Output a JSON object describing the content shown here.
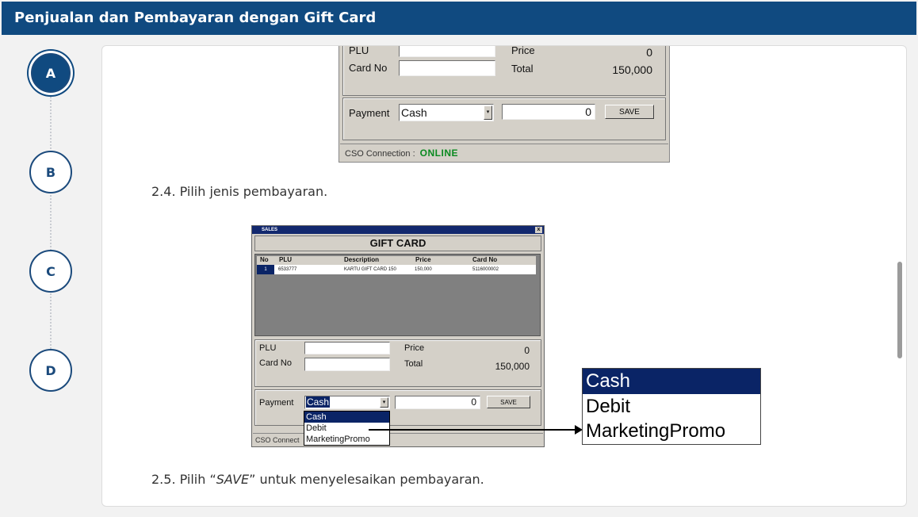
{
  "header": {
    "title": "Penjualan dan Pembayaran dengan Gift Card"
  },
  "steps": [
    {
      "label": "A",
      "active": true
    },
    {
      "label": "B",
      "active": false
    },
    {
      "label": "C",
      "active": false
    },
    {
      "label": "D",
      "active": false
    }
  ],
  "window_top": {
    "plu_label": "PLU",
    "cardno_label": "Card No",
    "price_label": "Price",
    "price_value": "0",
    "total_label": "Total",
    "total_value": "150,000",
    "payment_label": "Payment",
    "payment_value": "Cash",
    "amount_value": "0",
    "save_label": "SAVE",
    "status_label": "CSO Connection :",
    "status_value": "ONLINE"
  },
  "instruction_24": "2.4.  Pilih jenis pembayaran.",
  "instruction_25": {
    "prefix": "2.5.  Pilih “",
    "emph": "SAVE",
    "suffix": "” untuk menyelesaikan pembayaran."
  },
  "sales_window": {
    "title": "SALES",
    "close": "x",
    "banner": "GIFT CARD",
    "columns": [
      "No",
      "PLU",
      "Description",
      "Price",
      "Card No"
    ],
    "row": {
      "no": "1",
      "plu": "6533777",
      "description": "KARTU GIFT CARD 150",
      "price": "150,000",
      "card_no": "5116000002"
    },
    "plu_label": "PLU",
    "cardno_label": "Card No",
    "price_label": "Price",
    "price_value": "0",
    "total_label": "Total",
    "total_value": "150,000",
    "payment_label": "Payment",
    "payment_value": "Cash",
    "amount_value": "0",
    "save_label": "SAVE",
    "status_label": "CSO Connect",
    "options": [
      "Cash",
      "Debit",
      "MarketingPromo"
    ]
  },
  "zoom_options": [
    "Cash",
    "Debit",
    "MarketingPromo"
  ],
  "colors": {
    "header": "#104a80",
    "selection": "#0a2466",
    "online": "#0a8a20"
  }
}
